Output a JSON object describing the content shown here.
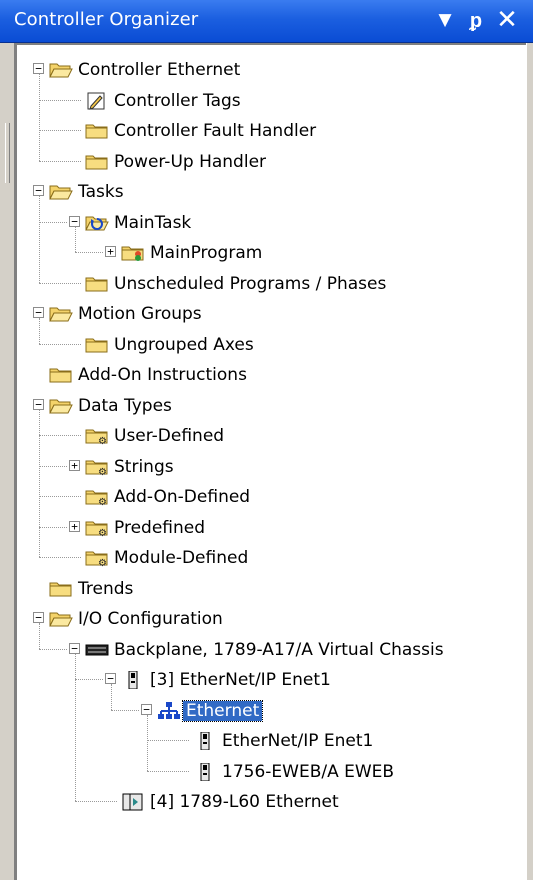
{
  "window": {
    "title": "Controller Organizer",
    "dropdown_icon": "dropdown-arrow-icon",
    "pin_icon": "pin-icon",
    "close_icon": "close-icon"
  },
  "colors": {
    "titlebar": "#1b5fe0",
    "selection": "#316ac5",
    "folder": "#f4d36a"
  },
  "tree": [
    {
      "label": "Controller Ethernet",
      "icon": "folder-open-icon",
      "expander": "minus",
      "depth": 0
    },
    {
      "label": "Controller Tags",
      "icon": "tags-icon",
      "expander": "",
      "depth": 1
    },
    {
      "label": "Controller Fault Handler",
      "icon": "folder-icon",
      "expander": "",
      "depth": 1
    },
    {
      "label": "Power-Up Handler",
      "icon": "folder-icon",
      "expander": "",
      "depth": 1
    },
    {
      "label": "Tasks",
      "icon": "folder-open-icon",
      "expander": "minus",
      "depth": 0
    },
    {
      "label": "MainTask",
      "icon": "task-icon",
      "expander": "minus",
      "depth": 1
    },
    {
      "label": "MainProgram",
      "icon": "program-icon",
      "expander": "plus",
      "depth": 2
    },
    {
      "label": "Unscheduled Programs / Phases",
      "icon": "folder-icon",
      "expander": "",
      "depth": 1
    },
    {
      "label": "Motion Groups",
      "icon": "folder-open-icon",
      "expander": "minus",
      "depth": 0
    },
    {
      "label": "Ungrouped Axes",
      "icon": "folder-icon",
      "expander": "",
      "depth": 1
    },
    {
      "label": "Add-On Instructions",
      "icon": "folder-icon",
      "expander": "",
      "depth": 0
    },
    {
      "label": "Data Types",
      "icon": "folder-open-icon",
      "expander": "minus",
      "depth": 0
    },
    {
      "label": "User-Defined",
      "icon": "datatype-folder-icon",
      "expander": "",
      "depth": 1
    },
    {
      "label": "Strings",
      "icon": "datatype-folder-icon",
      "expander": "plus",
      "depth": 1
    },
    {
      "label": "Add-On-Defined",
      "icon": "datatype-folder-icon",
      "expander": "",
      "depth": 1
    },
    {
      "label": "Predefined",
      "icon": "datatype-folder-icon",
      "expander": "plus",
      "depth": 1
    },
    {
      "label": "Module-Defined",
      "icon": "datatype-folder-icon",
      "expander": "",
      "depth": 1
    },
    {
      "label": "Trends",
      "icon": "folder-icon",
      "expander": "",
      "depth": 0
    },
    {
      "label": "I/O Configuration",
      "icon": "folder-open-icon",
      "expander": "minus",
      "depth": 0
    },
    {
      "label": "Backplane, 1789-A17/A Virtual Chassis",
      "icon": "backplane-icon",
      "expander": "minus",
      "depth": 1
    },
    {
      "label": "[3] EtherNet/IP Enet1",
      "icon": "module-icon",
      "expander": "minus",
      "depth": 2
    },
    {
      "label": "Ethernet",
      "icon": "network-icon",
      "expander": "minus",
      "depth": 3,
      "selected": true
    },
    {
      "label": "EtherNet/IP Enet1",
      "icon": "module-icon",
      "expander": "",
      "depth": 4
    },
    {
      "label": "1756-EWEB/A EWEB",
      "icon": "module-icon",
      "expander": "",
      "depth": 4
    },
    {
      "label": "[4] 1789-L60 Ethernet",
      "icon": "controller-module-icon",
      "expander": "",
      "depth": 2
    }
  ]
}
